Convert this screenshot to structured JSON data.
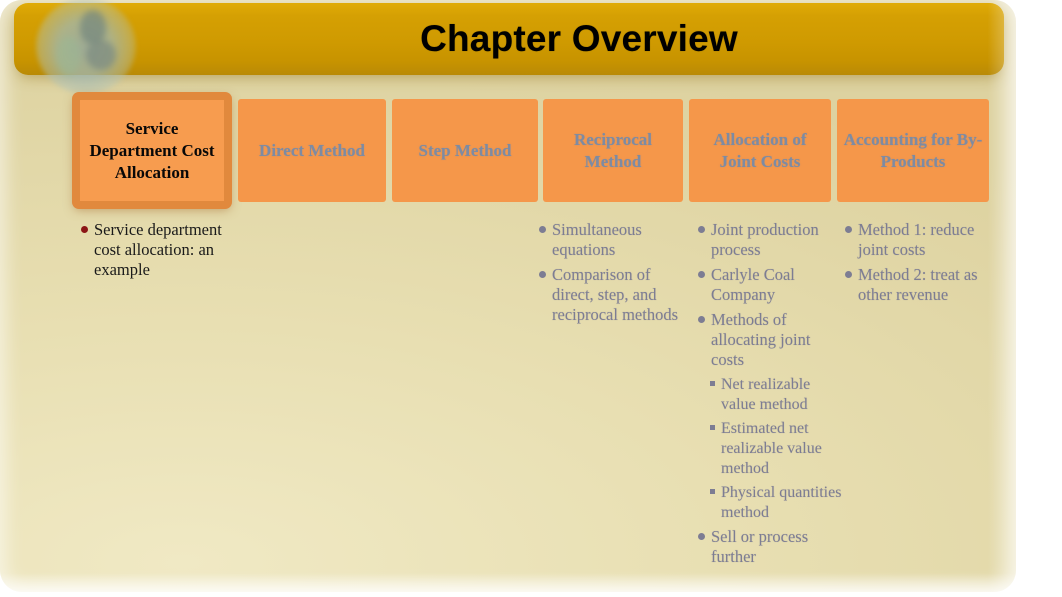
{
  "slide": {
    "title": "Chapter Overview",
    "colors": {
      "title_bar": "#cf9a01",
      "tab_fill": "#f5974a",
      "tab_active_fill": "#f79c4f",
      "tab_active_border": "#d07a30",
      "page_background": "#e8dfb2",
      "inactive_text": "#7d8ba3",
      "body_text_inactive": "#7d7d93",
      "active_text": "#000000",
      "active_bullet": "#8c1616"
    },
    "emblem": "university-seal-logo"
  },
  "tabs": [
    {
      "label": "Service Department Cost Allocation",
      "active": true
    },
    {
      "label": "Direct Method",
      "active": false
    },
    {
      "label": "Step Method",
      "active": false
    },
    {
      "label": "Reciprocal Method",
      "active": false
    },
    {
      "label": "Allocation of Joint Costs",
      "active": false
    },
    {
      "label": "Accounting for By-Products",
      "active": false
    }
  ],
  "columns": [
    {
      "active": true,
      "items": [
        {
          "level": 1,
          "text": "Service department cost allocation: an example"
        }
      ]
    },
    {
      "active": false,
      "items": []
    },
    {
      "active": false,
      "items": []
    },
    {
      "active": false,
      "items": [
        {
          "level": 1,
          "text": "Simultaneous equations"
        },
        {
          "level": 1,
          "text": "Comparison of direct, step, and reciprocal methods"
        }
      ]
    },
    {
      "active": false,
      "items": [
        {
          "level": 1,
          "text": "Joint production process"
        },
        {
          "level": 1,
          "text": "Carlyle Coal Company"
        },
        {
          "level": 1,
          "text": "Methods of allocating joint costs"
        },
        {
          "level": 2,
          "text": "Net realizable value method"
        },
        {
          "level": 2,
          "text": "Estimated net realizable value method"
        },
        {
          "level": 2,
          "text": "Physical quantities method"
        },
        {
          "level": 1,
          "text": "Sell or process further"
        }
      ]
    },
    {
      "active": false,
      "items": [
        {
          "level": 1,
          "text": "Method 1: reduce joint costs"
        },
        {
          "level": 1,
          "text": "Method 2: treat as other revenue"
        }
      ]
    }
  ]
}
